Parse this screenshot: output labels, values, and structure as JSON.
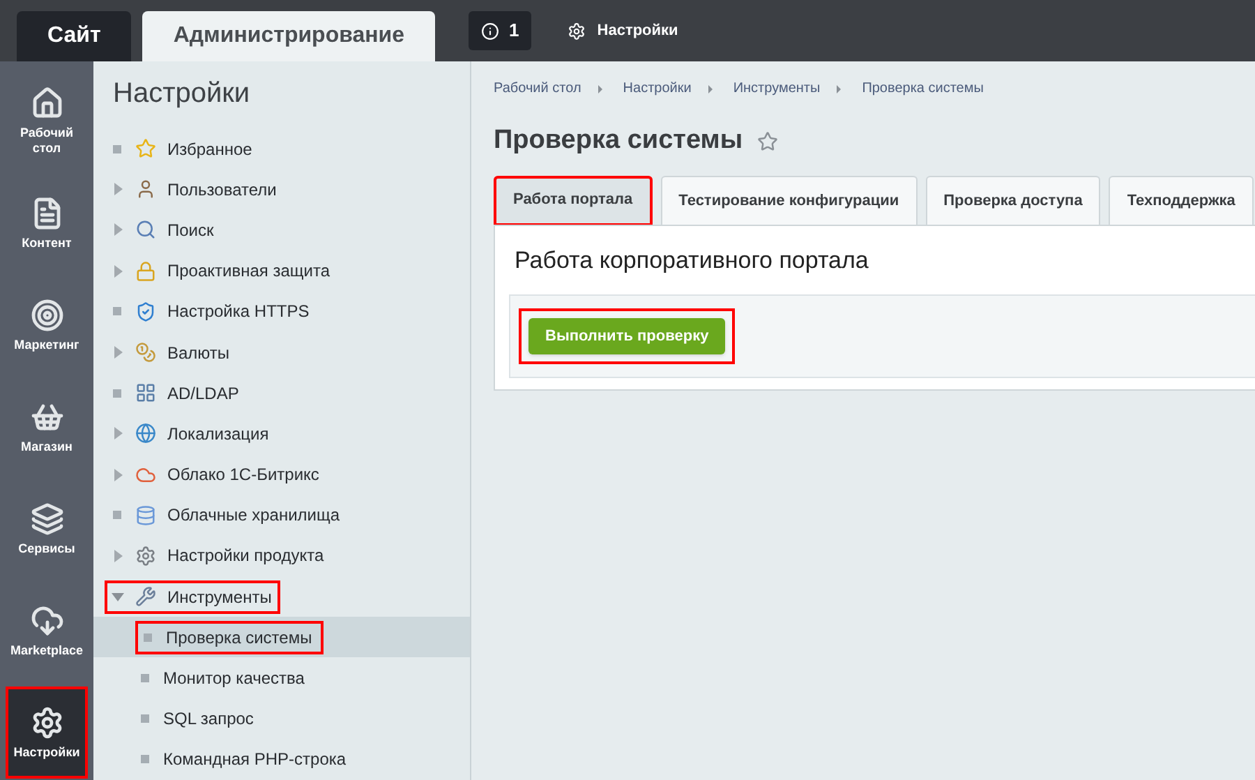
{
  "top_bar": {
    "tabs": [
      {
        "label": "Сайт",
        "selected": false
      },
      {
        "label": "Администрирование",
        "selected": true
      }
    ],
    "notifications": {
      "count": "1"
    },
    "settings_link": "Настройки"
  },
  "rail": {
    "items": [
      {
        "label": "Рабочий стол",
        "selected": false,
        "highlighted": false
      },
      {
        "label": "Контент",
        "selected": false,
        "highlighted": false
      },
      {
        "label": "Маркетинг",
        "selected": false,
        "highlighted": false
      },
      {
        "label": "Магазин",
        "selected": false,
        "highlighted": false
      },
      {
        "label": "Сервисы",
        "selected": false,
        "highlighted": false
      },
      {
        "label": "Marketplace",
        "selected": false,
        "highlighted": false
      },
      {
        "label": "Настройки",
        "selected": true,
        "highlighted": true
      }
    ]
  },
  "tree": {
    "title": "Настройки",
    "items": [
      {
        "label": "Избранное",
        "kind": "leaf",
        "highlighted": false
      },
      {
        "label": "Пользователи",
        "kind": "branch",
        "expanded": false,
        "highlighted": false
      },
      {
        "label": "Поиск",
        "kind": "branch",
        "expanded": false,
        "highlighted": false
      },
      {
        "label": "Проактивная защита",
        "kind": "branch",
        "expanded": false,
        "highlighted": false
      },
      {
        "label": "Настройка HTTPS",
        "kind": "leaf",
        "highlighted": false
      },
      {
        "label": "Валюты",
        "kind": "branch",
        "expanded": false,
        "highlighted": false
      },
      {
        "label": "AD/LDAP",
        "kind": "leaf",
        "highlighted": false
      },
      {
        "label": "Локализация",
        "kind": "branch",
        "expanded": false,
        "highlighted": false
      },
      {
        "label": "Облако 1С-Битрикс",
        "kind": "branch",
        "expanded": false,
        "highlighted": false
      },
      {
        "label": "Облачные хранилища",
        "kind": "leaf",
        "highlighted": false
      },
      {
        "label": "Настройки продукта",
        "kind": "branch",
        "expanded": false,
        "highlighted": false
      },
      {
        "label": "Инструменты",
        "kind": "branch",
        "expanded": true,
        "highlighted": true,
        "children": [
          {
            "label": "Проверка системы",
            "selected": true,
            "highlighted": true
          },
          {
            "label": "Монитор качества",
            "selected": false,
            "highlighted": false
          },
          {
            "label": "SQL запрос",
            "selected": false,
            "highlighted": false
          },
          {
            "label": "Командная PHP-строка",
            "selected": false,
            "highlighted": false
          }
        ]
      }
    ]
  },
  "breadcrumbs": [
    "Рабочий стол",
    "Настройки",
    "Инструменты",
    "Проверка системы"
  ],
  "page_title": "Проверка системы",
  "favorite": {
    "starred": false
  },
  "tabs": [
    {
      "label": "Работа портала",
      "selected": true,
      "highlighted": true
    },
    {
      "label": "Тестирование конфигурации",
      "selected": false,
      "highlighted": false
    },
    {
      "label": "Проверка доступа",
      "selected": false,
      "highlighted": false
    },
    {
      "label": "Техподдержка",
      "selected": false,
      "highlighted": false
    }
  ],
  "panel": {
    "heading": "Работа корпоративного портала",
    "button": {
      "label": "Выполнить проверку",
      "highlighted": true
    }
  }
}
